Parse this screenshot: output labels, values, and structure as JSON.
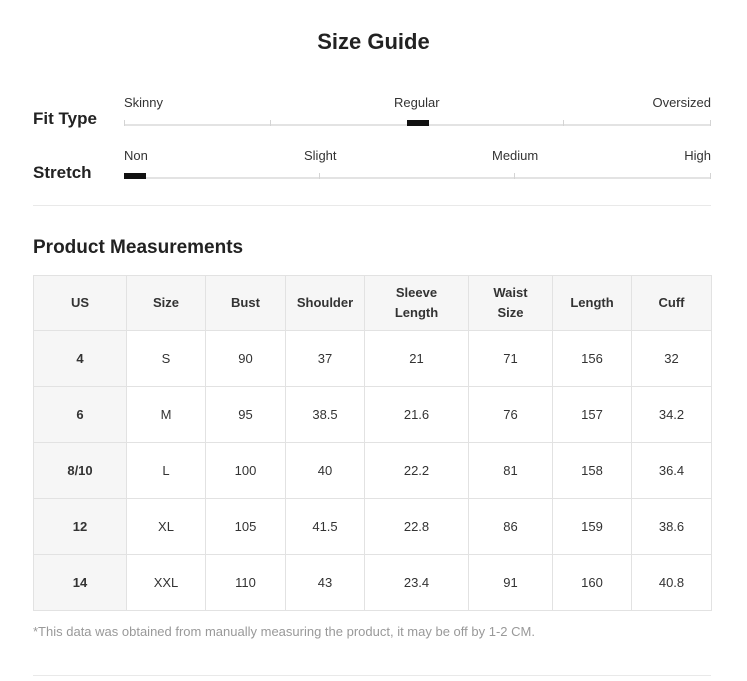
{
  "title": "Size Guide",
  "fit_type": {
    "label": "Fit Type",
    "options": [
      "Skinny",
      "Regular",
      "Oversized"
    ],
    "selected": "Regular"
  },
  "stretch": {
    "label": "Stretch",
    "options": [
      "Non",
      "Slight",
      "Medium",
      "High"
    ],
    "selected": "Non"
  },
  "measurements": {
    "title": "Product Measurements",
    "headers": [
      "US",
      "Size",
      "Bust",
      "Shoulder",
      "Sleeve\nLength",
      "Waist\nSize",
      "Length",
      "Cuff"
    ],
    "rows": [
      [
        "4",
        "S",
        "90",
        "37",
        "21",
        "71",
        "156",
        "32"
      ],
      [
        "6",
        "M",
        "95",
        "38.5",
        "21.6",
        "76",
        "157",
        "34.2"
      ],
      [
        "8/10",
        "L",
        "100",
        "40",
        "22.2",
        "81",
        "158",
        "36.4"
      ],
      [
        "12",
        "XL",
        "105",
        "41.5",
        "22.8",
        "86",
        "159",
        "38.6"
      ],
      [
        "14",
        "XXL",
        "110",
        "43",
        "23.4",
        "91",
        "160",
        "40.8"
      ]
    ]
  },
  "note": "*This data was obtained from manually measuring the product, it may be off by 1-2 CM."
}
